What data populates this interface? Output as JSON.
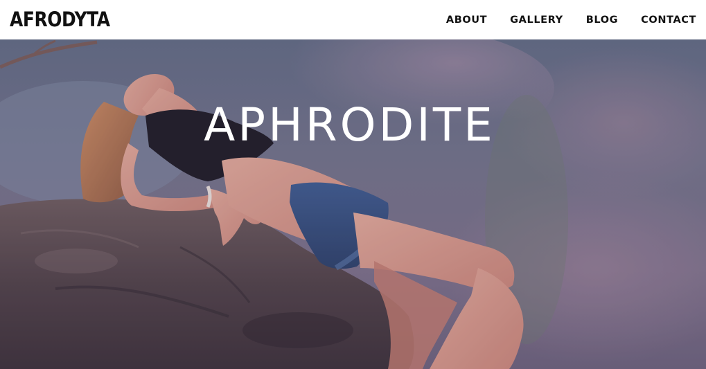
{
  "brand": {
    "name": "AFRODYTA"
  },
  "nav": {
    "items": [
      {
        "label": "ABOUT"
      },
      {
        "label": "GALLERY"
      },
      {
        "label": "BLOG"
      },
      {
        "label": "CONTACT"
      }
    ]
  },
  "hero": {
    "title": "APHRODITE",
    "image_icon": "hero-photo",
    "overlay_color": "#5a4a78"
  }
}
